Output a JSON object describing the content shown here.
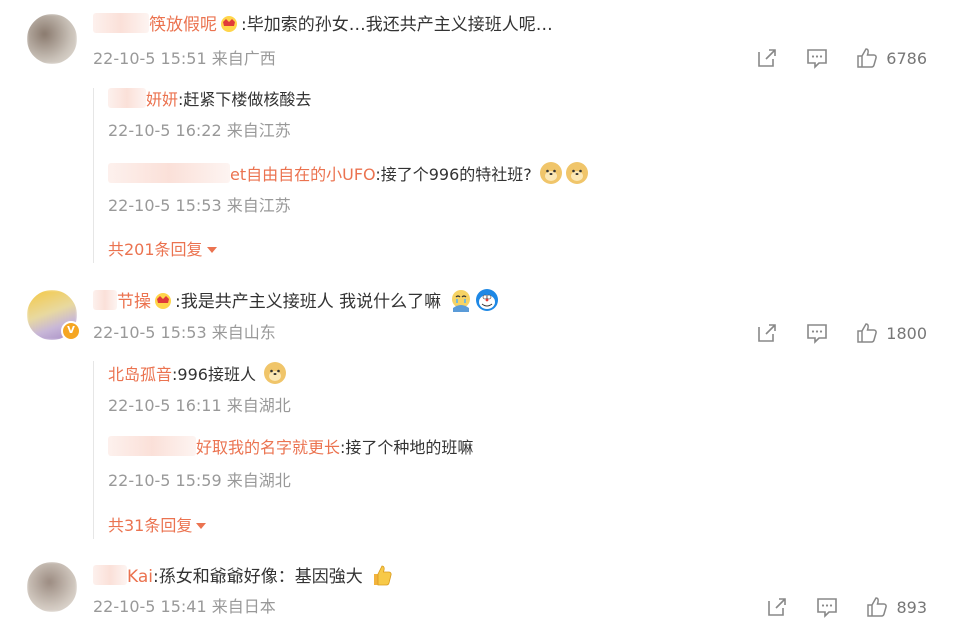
{
  "comments": [
    {
      "name": "筷放假呢",
      "text": "毕加索的孙女…我还共产主义接班人呢…",
      "meta": "22-10-5 15:51 来自广西",
      "likes": "6786",
      "replies": [
        {
          "name": "妍妍",
          "text": "赶紧下楼做核酸去",
          "meta": "22-10-5 16:22 来自江苏"
        },
        {
          "name": "et自由自在的小UFO",
          "text": "接了个996的特社班?",
          "meta": "22-10-5 15:53 来自江苏"
        }
      ],
      "more": "共201条回复"
    },
    {
      "name": "节操",
      "text": "我是共产主义接班人 我说什么了嘛",
      "meta": "22-10-5 15:53 来自山东",
      "likes": "1800",
      "replies": [
        {
          "name": "北岛孤音",
          "text": "996接班人",
          "meta": "22-10-5 16:11 来自湖北"
        },
        {
          "name": "好取我的名字就更长",
          "text": "接了个种地的班嘛",
          "meta": "22-10-5 15:59 来自湖北"
        }
      ],
      "more": "共31条回复"
    },
    {
      "name": "Kai",
      "text": "孫女和爺爺好像：基因強大",
      "meta": "22-10-5 15:41 来自日本",
      "likes": "893"
    }
  ],
  "colors": {
    "name": "#eb7350",
    "meta": "#999999",
    "text": "#333333"
  },
  "icons": {
    "share": "share-icon",
    "comment": "comment-icon",
    "like": "thumbs-up-icon",
    "caret": "caret-down-icon"
  }
}
